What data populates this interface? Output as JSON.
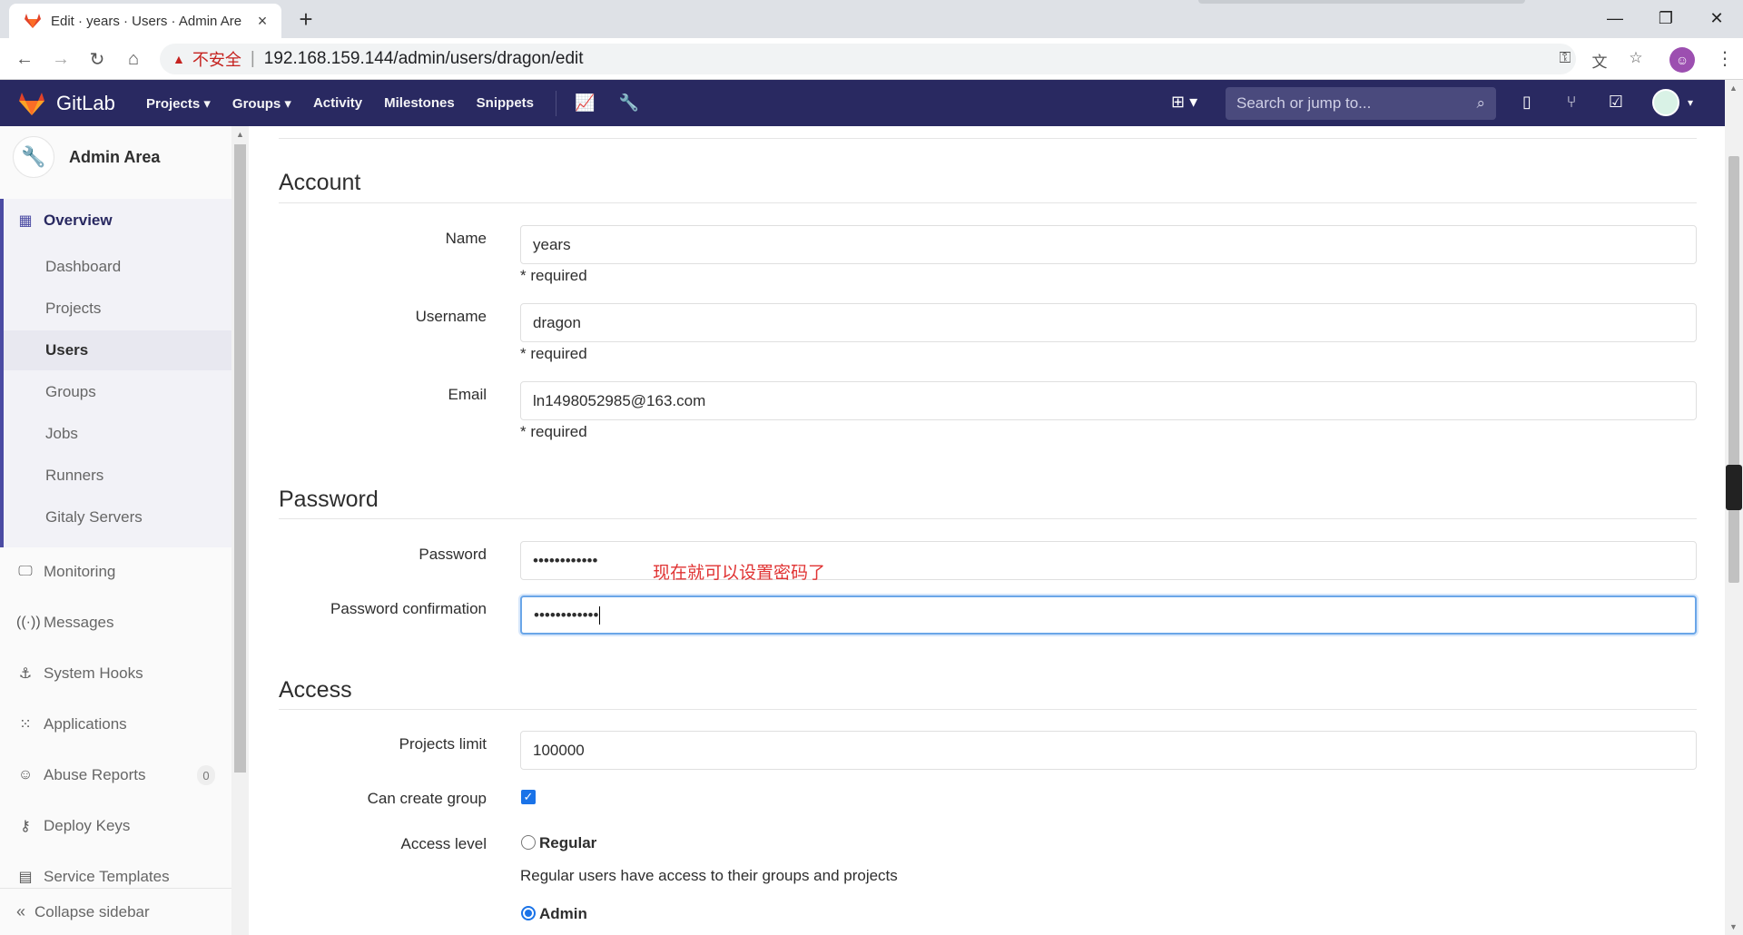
{
  "browser": {
    "tab_title": "Edit · years · Users · Admin Are",
    "tab_close": "×",
    "new_tab": "+",
    "insecure_label": "不安全",
    "separator": "|",
    "url": "192.168.159.144/admin/users/dragon/edit"
  },
  "header": {
    "brand": "GitLab",
    "nav": [
      "Projects",
      "Groups",
      "Activity",
      "Milestones",
      "Snippets"
    ],
    "search_placeholder": "Search or jump to..."
  },
  "sidebar": {
    "title": "Admin Area",
    "overview": "Overview",
    "overview_items": [
      "Dashboard",
      "Projects",
      "Users",
      "Groups",
      "Jobs",
      "Runners",
      "Gitaly Servers"
    ],
    "active_item": "Users",
    "items": [
      {
        "label": "Monitoring",
        "icon": "monitor-icon"
      },
      {
        "label": "Messages",
        "icon": "broadcast-icon"
      },
      {
        "label": "System Hooks",
        "icon": "hook-icon"
      },
      {
        "label": "Applications",
        "icon": "apps-grid-icon"
      },
      {
        "label": "Abuse Reports",
        "icon": "face-icon",
        "badge": "0"
      },
      {
        "label": "Deploy Keys",
        "icon": "key-icon"
      },
      {
        "label": "Service Templates",
        "icon": "template-icon"
      }
    ],
    "collapse": "Collapse sidebar"
  },
  "form": {
    "account_title": "Account",
    "name_label": "Name",
    "name_value": "years",
    "username_label": "Username",
    "username_value": "dragon",
    "email_label": "Email",
    "email_value": "ln1498052985@163.com",
    "required": "* required",
    "password_title": "Password",
    "password_label": "Password",
    "password_value": "••••••••••••",
    "password_confirm_label": "Password confirmation",
    "password_confirm_value": "••••••••••••",
    "annotation": "现在就可以设置密码了",
    "access_title": "Access",
    "projects_limit_label": "Projects limit",
    "projects_limit_value": "100000",
    "can_create_group_label": "Can create group",
    "can_create_group_checked": true,
    "access_level_label": "Access level",
    "regular_label": "Regular",
    "regular_desc": "Regular users have access to their groups and projects",
    "admin_label": "Admin",
    "selected_access_level": "Admin"
  },
  "colors": {
    "header_bg": "#292961",
    "accent": "#1a73e8",
    "annotation": "#e03333"
  }
}
